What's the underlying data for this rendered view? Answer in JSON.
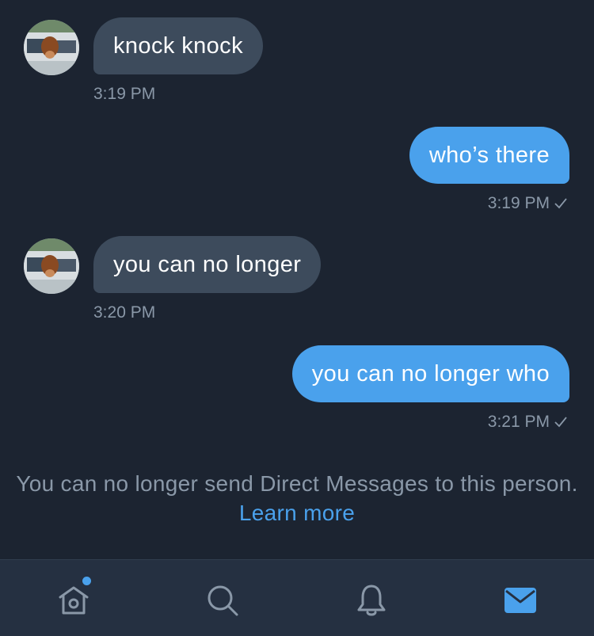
{
  "messages": [
    {
      "text": "knock knock",
      "time": "3:19 PM",
      "direction": "received"
    },
    {
      "text": "who’s there",
      "time": "3:19 PM",
      "direction": "sent"
    },
    {
      "text": "you can no longer",
      "time": "3:20 PM",
      "direction": "received"
    },
    {
      "text": "you can no longer who",
      "time": "3:21 PM",
      "direction": "sent"
    }
  ],
  "notice": {
    "text": "You can no longer send Direct Messages to this person.",
    "link": "Learn more"
  },
  "tabbar": {
    "items": [
      {
        "icon": "home-icon",
        "has_notification_dot": true,
        "active": false
      },
      {
        "icon": "search-icon",
        "active": false
      },
      {
        "icon": "bell-icon",
        "active": false
      },
      {
        "icon": "mail-icon",
        "active": true
      }
    ]
  },
  "colors": {
    "background": "#1c2431",
    "received_bubble": "#3d4b5c",
    "sent_bubble": "#4aa1ec",
    "muted_text": "#8a98a8",
    "accent": "#4aa1ec",
    "tabbar_background": "#253041",
    "tab_icon": "#8a98a8"
  }
}
